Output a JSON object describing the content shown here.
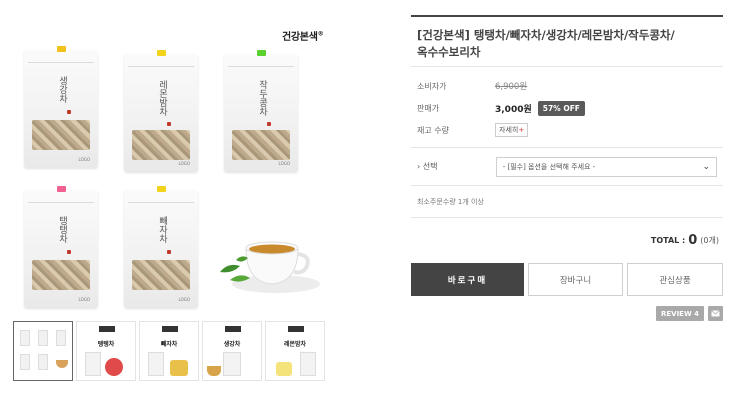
{
  "brand": {
    "name": "건강본색",
    "mark": "®"
  },
  "pouches": [
    {
      "name": "생강차",
      "tag_color": "#f2c11a"
    },
    {
      "name": "레몬밤차",
      "tag_color": "#f2d21a"
    },
    {
      "name": "작두콩차",
      "tag_color": "#5bd12f"
    },
    {
      "name": "탱탱차",
      "tag_color": "#f06292"
    },
    {
      "name": "빼자차",
      "tag_color": "#f2d21a"
    }
  ],
  "thumbnails": [
    {
      "label": ""
    },
    {
      "label": "탱탱차"
    },
    {
      "label": "빼자차"
    },
    {
      "label": "생강차"
    },
    {
      "label": "레몬밤차"
    }
  ],
  "product": {
    "title": "[건강본색] 탱탱차/빼자차/생강차/레몬밤차/작두콩차/옥수수보리차",
    "consumer_price_label": "소비자가",
    "consumer_price": "6,900원",
    "sale_price_label": "판매가",
    "sale_price": "3,000원",
    "discount": "57% OFF",
    "stock_label": "재고 수량",
    "stock_button": "자세히",
    "stock_button_mark": "+"
  },
  "option": {
    "label": "› 선택",
    "placeholder": "- [필수] 옵션을 선택해 주세요 -"
  },
  "min_quantity": "최소주문수량 1개 이상",
  "total": {
    "label": "TOTAL :",
    "amount": "0",
    "count": "(0개)"
  },
  "buttons": {
    "buy": "바로구매",
    "cart": "장바구니",
    "wish": "관심상품"
  },
  "review": {
    "label": "REVIEW 4"
  },
  "colors": {
    "dark": "#444444",
    "discount_bg": "#5a5a5a",
    "review_bg": "#a9a9a9"
  }
}
